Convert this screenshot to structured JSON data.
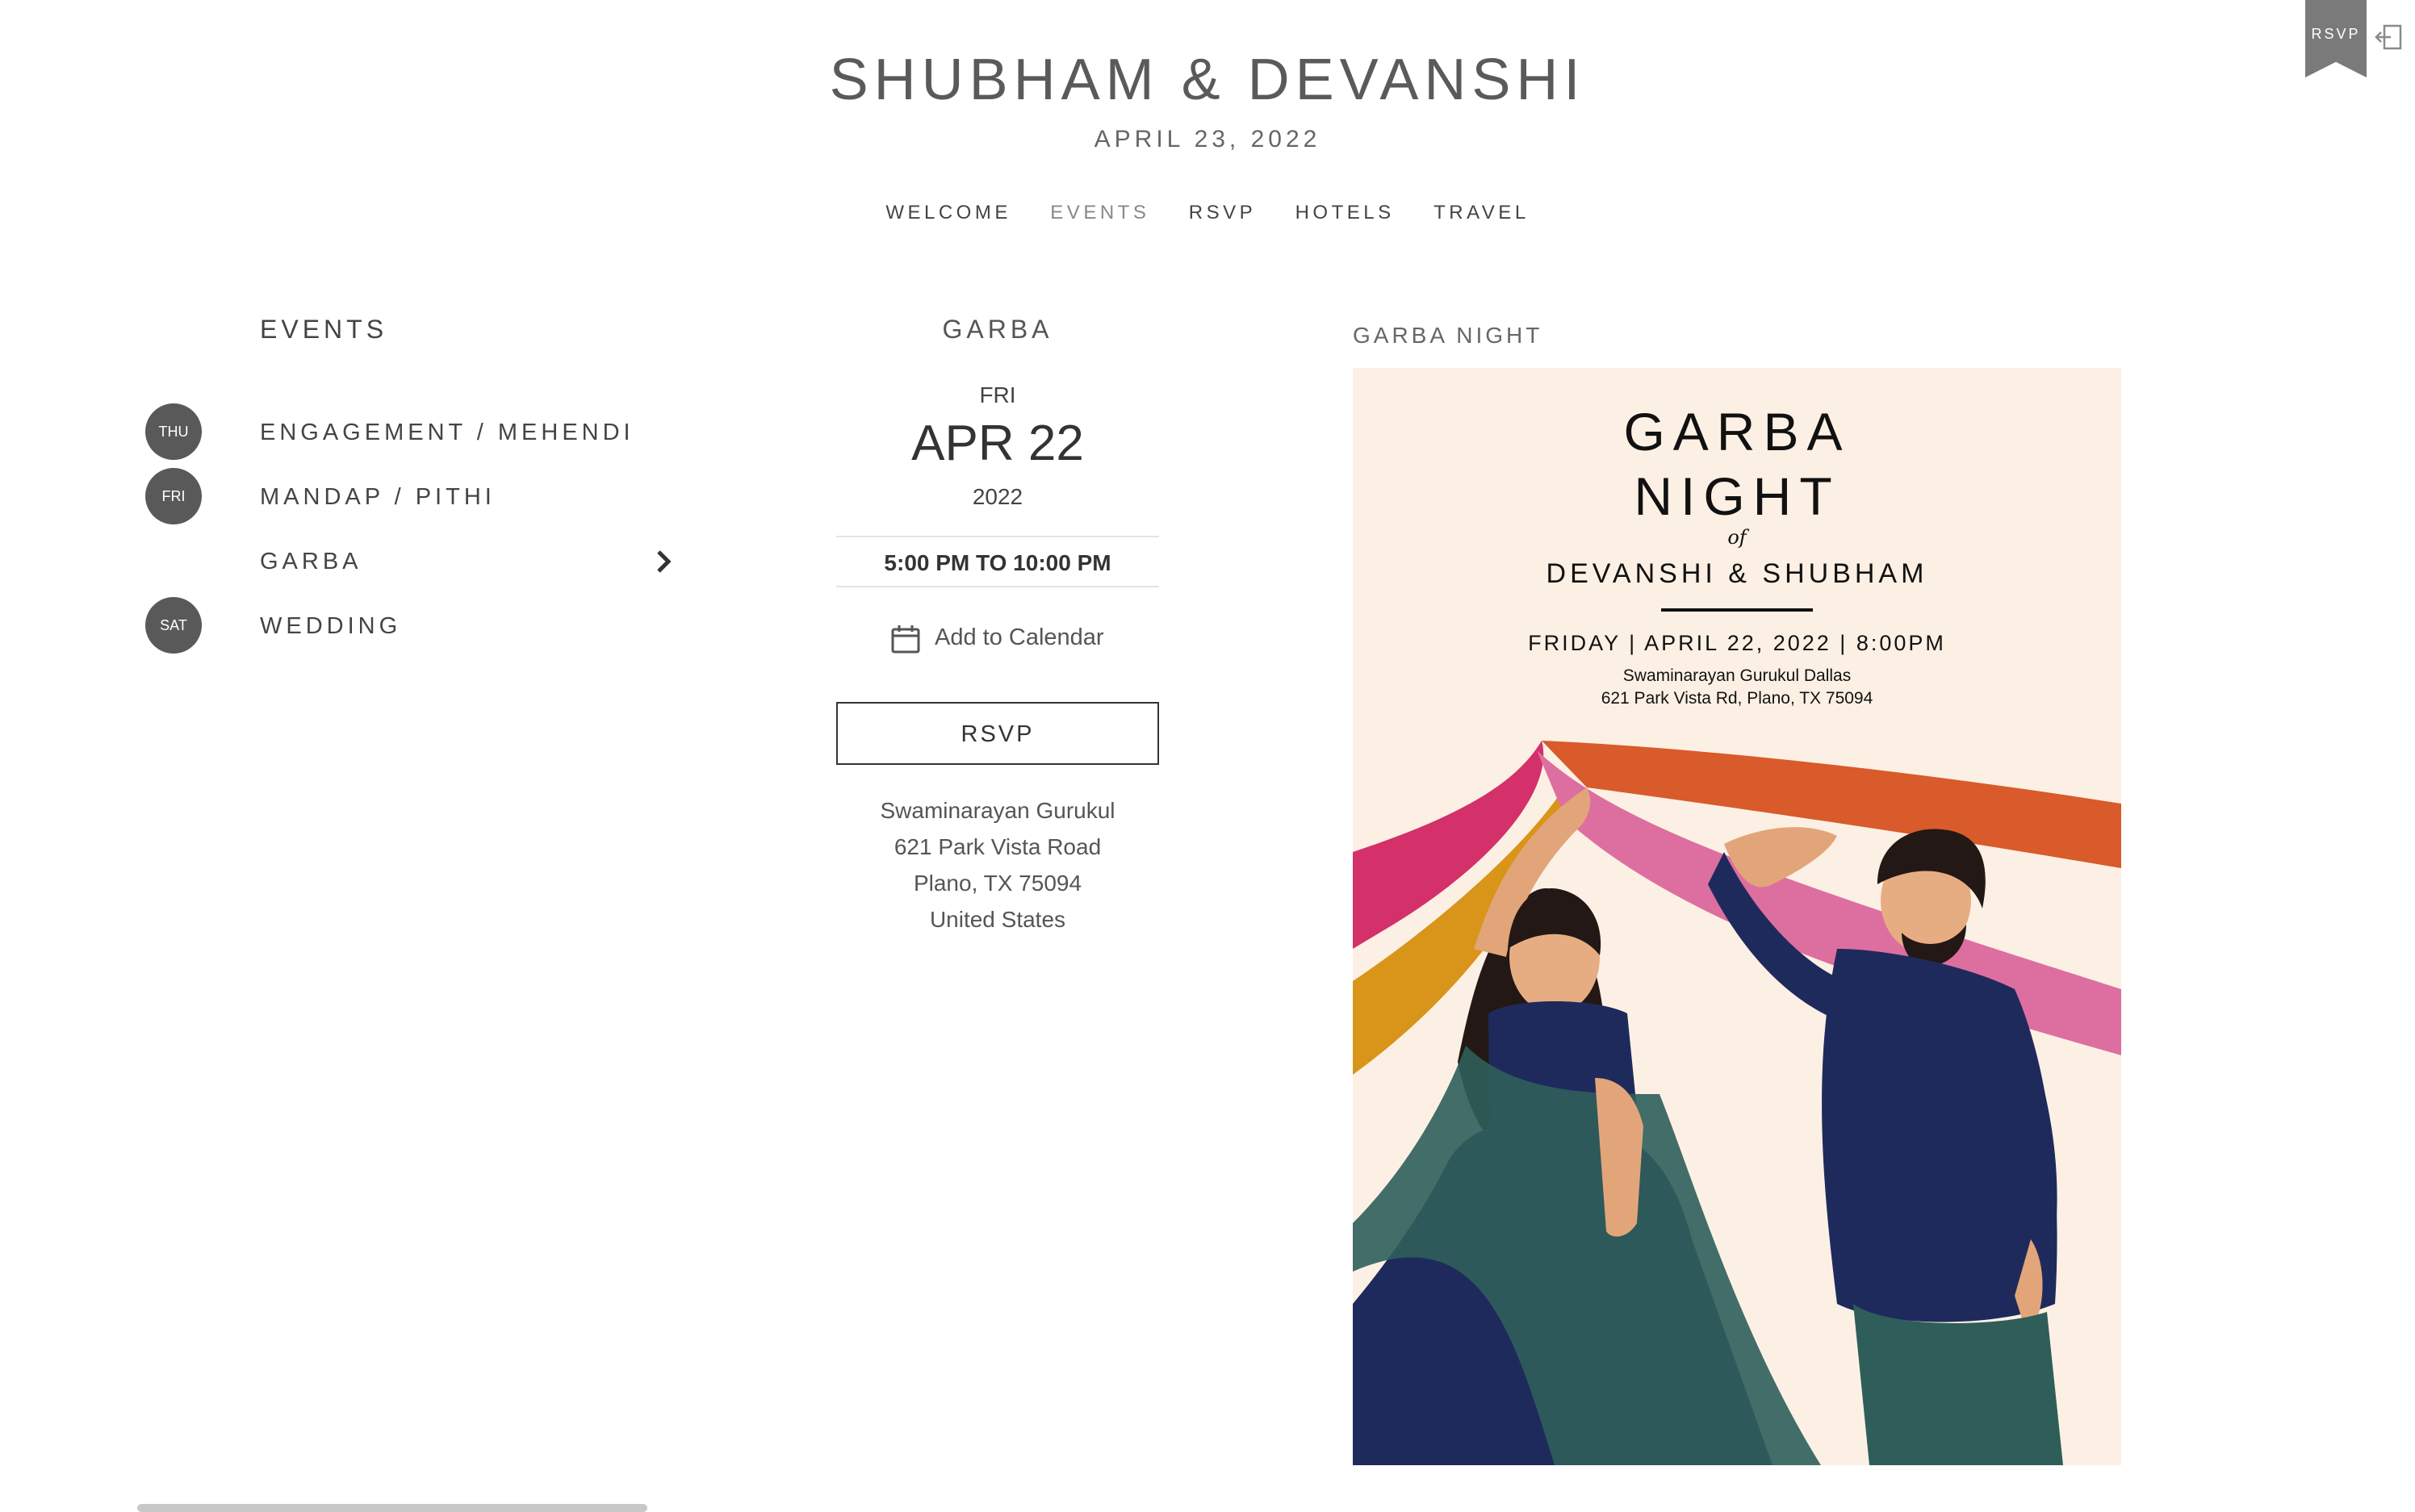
{
  "header": {
    "couple": "SHUBHAM & DEVANSHI",
    "date": "APRIL 23, 2022",
    "ribbon": "RSVP"
  },
  "nav": [
    "WELCOME",
    "EVENTS",
    "RSVP",
    "HOTELS",
    "TRAVEL"
  ],
  "nav_active": "EVENTS",
  "events": {
    "title": "EVENTS",
    "items": [
      {
        "badge": "THU",
        "label": "ENGAGEMENT / MEHENDI"
      },
      {
        "badge": "FRI",
        "label": "MANDAP / PITHI"
      },
      {
        "badge": "",
        "label": "GARBA"
      },
      {
        "badge": "SAT",
        "label": "WEDDING"
      }
    ]
  },
  "detail": {
    "title": "GARBA",
    "dow": "FRI",
    "day": "APR 22",
    "year": "2022",
    "time": "5:00 PM TO 10:00 PM",
    "add_calendar": "Add to Calendar",
    "rsvp": "RSVP",
    "address": [
      "Swaminarayan Gurukul",
      "621 Park Vista Road",
      "Plano, TX 75094",
      "United States"
    ]
  },
  "invitation": {
    "caption": "GARBA NIGHT",
    "line1": "GARBA",
    "line2": "NIGHT",
    "of": "of",
    "names": "DEVANSHI & SHUBHAM",
    "when": "FRIDAY | APRIL 22, 2022 | 8:00PM",
    "venue": "Swaminarayan Gurukul Dallas",
    "venue_addr": "621 Park Vista Rd, Plano, TX 75094"
  },
  "colors": {
    "badge": "#595959",
    "invite_bg": "#fcf0e4",
    "navy": "#1f2a5c",
    "teal": "#2f5e5a",
    "magenta": "#d4306a",
    "orange": "#d95a2a",
    "mustard": "#d9941a",
    "pink": "#dd6fa0"
  }
}
